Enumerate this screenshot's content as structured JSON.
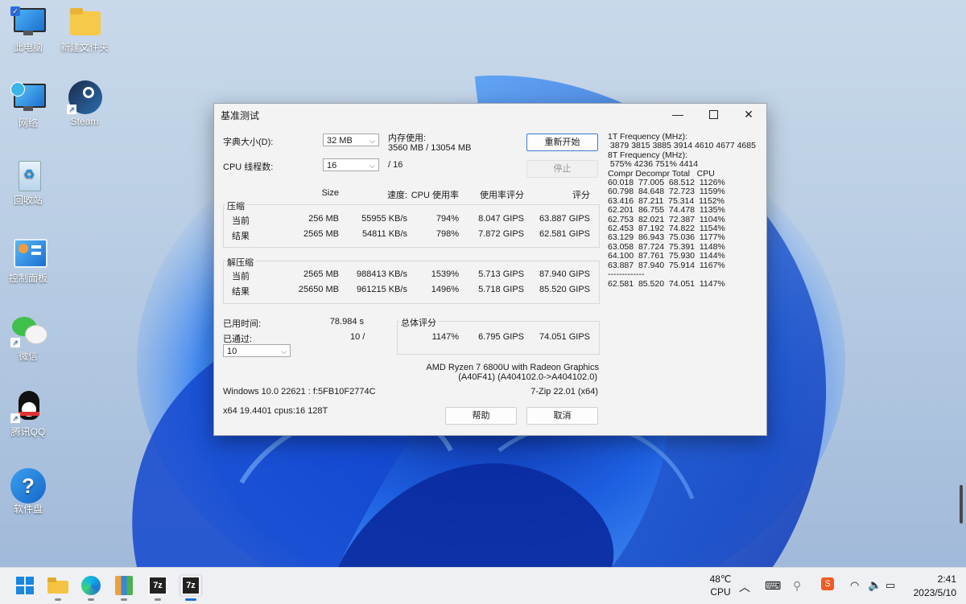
{
  "desktop": {
    "icons": [
      {
        "label": "此电脑",
        "icon": "computer-icon"
      },
      {
        "label": "新建文件夹",
        "icon": "folder-icon"
      },
      {
        "label": "网络",
        "icon": "network-icon"
      },
      {
        "label": "Steam",
        "icon": "steam-icon"
      },
      {
        "label": "回收站",
        "icon": "recycle-bin-icon"
      },
      {
        "label": "控制面板",
        "icon": "control-panel-icon"
      },
      {
        "label": "微信",
        "icon": "wechat-icon"
      },
      {
        "label": "腾讯QQ",
        "icon": "qq-icon"
      },
      {
        "label": "软件盘",
        "icon": "help-icon"
      }
    ]
  },
  "window": {
    "title": "基准测试",
    "dict_size_label": "字典大小(D):",
    "dict_size_value": "32 MB",
    "threads_label": "CPU 线程数:",
    "threads_value": "16",
    "threads_total": "/ 16",
    "memory_label": "内存使用:",
    "memory_value": "3560 MB / 13054 MB",
    "restart_label": "重新开始",
    "stop_label": "停止",
    "headers": {
      "size": "Size",
      "speed": "速度:",
      "cpu_usage": "CPU 使用率",
      "rating_per_usage": "使用率评分",
      "rating": "评分"
    },
    "compress": {
      "title": "压缩",
      "rows": [
        {
          "label": "当前",
          "size": "256 MB",
          "speed": "55955 KB/s",
          "usage": "794%",
          "ru": "8.047 GIPS",
          "rating": "63.887 GIPS"
        },
        {
          "label": "结果",
          "size": "2565 MB",
          "speed": "54811 KB/s",
          "usage": "798%",
          "ru": "7.872 GIPS",
          "rating": "62.581 GIPS"
        }
      ]
    },
    "decompress": {
      "title": "解压缩",
      "rows": [
        {
          "label": "当前",
          "size": "2565 MB",
          "speed": "988413 KB/s",
          "usage": "1539%",
          "ru": "5.713 GIPS",
          "rating": "87.940 GIPS"
        },
        {
          "label": "结果",
          "size": "25650 MB",
          "speed": "961215 KB/s",
          "usage": "1496%",
          "ru": "5.718 GIPS",
          "rating": "85.520 GIPS"
        }
      ]
    },
    "elapsed_label": "已用时间:",
    "elapsed_value": "78.984 s",
    "passed_label": "已通过:",
    "passed_value": "10 /",
    "passes_combo": "10",
    "total_label": "总体评分",
    "total_usage": "1147%",
    "total_ru": "6.795 GIPS",
    "total_rating": "74.051 GIPS",
    "cpu_name": "AMD Ryzen 7 6800U with Radeon Graphics",
    "cpu_id": "(A40F41) (A404102.0->A404102.0)",
    "os_info": "Windows 10.0 22621 : f:5FB10F2774C",
    "app_version": "7-Zip 22.01 (x64)",
    "arch_info": "x64 19.4401 cpus:16 128T",
    "help_label": "帮助",
    "cancel_label": "取消",
    "freq_lines": [
      "1T Frequency (MHz):",
      " 3879 3815 3885 3914 4610 4677 4685",
      "8T Frequency (MHz):",
      " 575% 4236 751% 4414",
      "Compr Decompr Total   CPU",
      "60.018  77.005  68.512  1126%",
      "60.798  84.648  72.723  1159%",
      "63.416  87.211  75.314  1152%",
      "62.201  86.755  74.478  1135%",
      "62.753  82.021  72.387  1104%",
      "62.453  87.192  74.822  1154%",
      "63.129  86.943  75.036  1177%",
      "63.058  87.724  75.391  1148%",
      "64.100  87.761  75.930  1144%",
      "63.887  87.940  75.914  1167%",
      "-------------",
      "62.581  85.520  74.051  1147%"
    ]
  },
  "taskbar": {
    "temp": "48℃",
    "temp_label": "CPU",
    "time": "2:41",
    "date": "2023/5/10"
  }
}
